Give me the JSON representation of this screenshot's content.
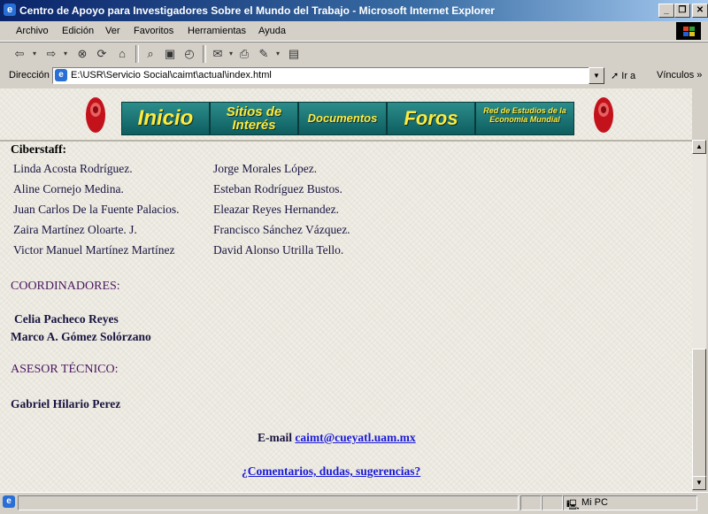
{
  "window": {
    "title": "Centro de Apoyo para Investigadores Sobre el Mundo del Trabajo - Microsoft Internet Explorer",
    "minimize_glyph": "_",
    "maximize_glyph": "❐",
    "close_glyph": "✕"
  },
  "menu": [
    "Archivo",
    "Edición",
    "Ver",
    "Favoritos",
    "Herramientas",
    "Ayuda"
  ],
  "address": {
    "label": "Dirección",
    "url": "E:\\USR\\Servicio Social\\caimt\\actual\\index.html",
    "go_label": "Ir a",
    "links_label": "Vínculos"
  },
  "nav": {
    "inicio": "Inicio",
    "sitios": "Sitios de Interés",
    "documentos": "Documentos",
    "foros": "Foros",
    "red": "Red de Estudios de la Economía Mundial"
  },
  "content": {
    "ciberstaff_title": "Ciberstaff:",
    "staff_left": [
      "Linda Acosta Rodríguez.",
      "Aline Cornejo Medina.",
      "Juan Carlos De la Fuente Palacios.",
      "Zaira Martínez Oloarte. J.",
      "Victor Manuel Martínez Martínez"
    ],
    "staff_right": [
      "Jorge Morales López.",
      "Esteban Rodríguez Bustos.",
      "Eleazar Reyes Hernandez.",
      "Francisco Sánchez Vázquez.",
      "David Alonso Utrilla Tello."
    ],
    "coordinadores_title": "COORDINADORES:",
    "coordinadores": [
      "Celia Pacheco Reyes",
      "Marco A. Gómez Solórzano"
    ],
    "asesor_title": "ASESOR TÉCNICO:",
    "asesor": "Gabriel Hilario Perez",
    "email_label": "E-mail",
    "email": "caimt@cueyatl.uam.mx",
    "comments_link": "¿Comentarios, dudas, sugerencias?"
  },
  "status": {
    "zone": "Mi PC"
  },
  "colors": {
    "titlebar": "#0a246a",
    "nav_text": "#ffeb3b",
    "nav_bg": "#1a7676",
    "link": "#1a1ad8",
    "heading": "#4a1660"
  },
  "icons": [
    "ie-icon",
    "back-icon",
    "forward-icon",
    "stop-icon",
    "refresh-icon",
    "home-icon",
    "search-icon",
    "favorites-icon",
    "history-icon",
    "mail-icon",
    "print-icon",
    "edit-icon",
    "discuss-icon",
    "go-icon",
    "computer-icon"
  ]
}
